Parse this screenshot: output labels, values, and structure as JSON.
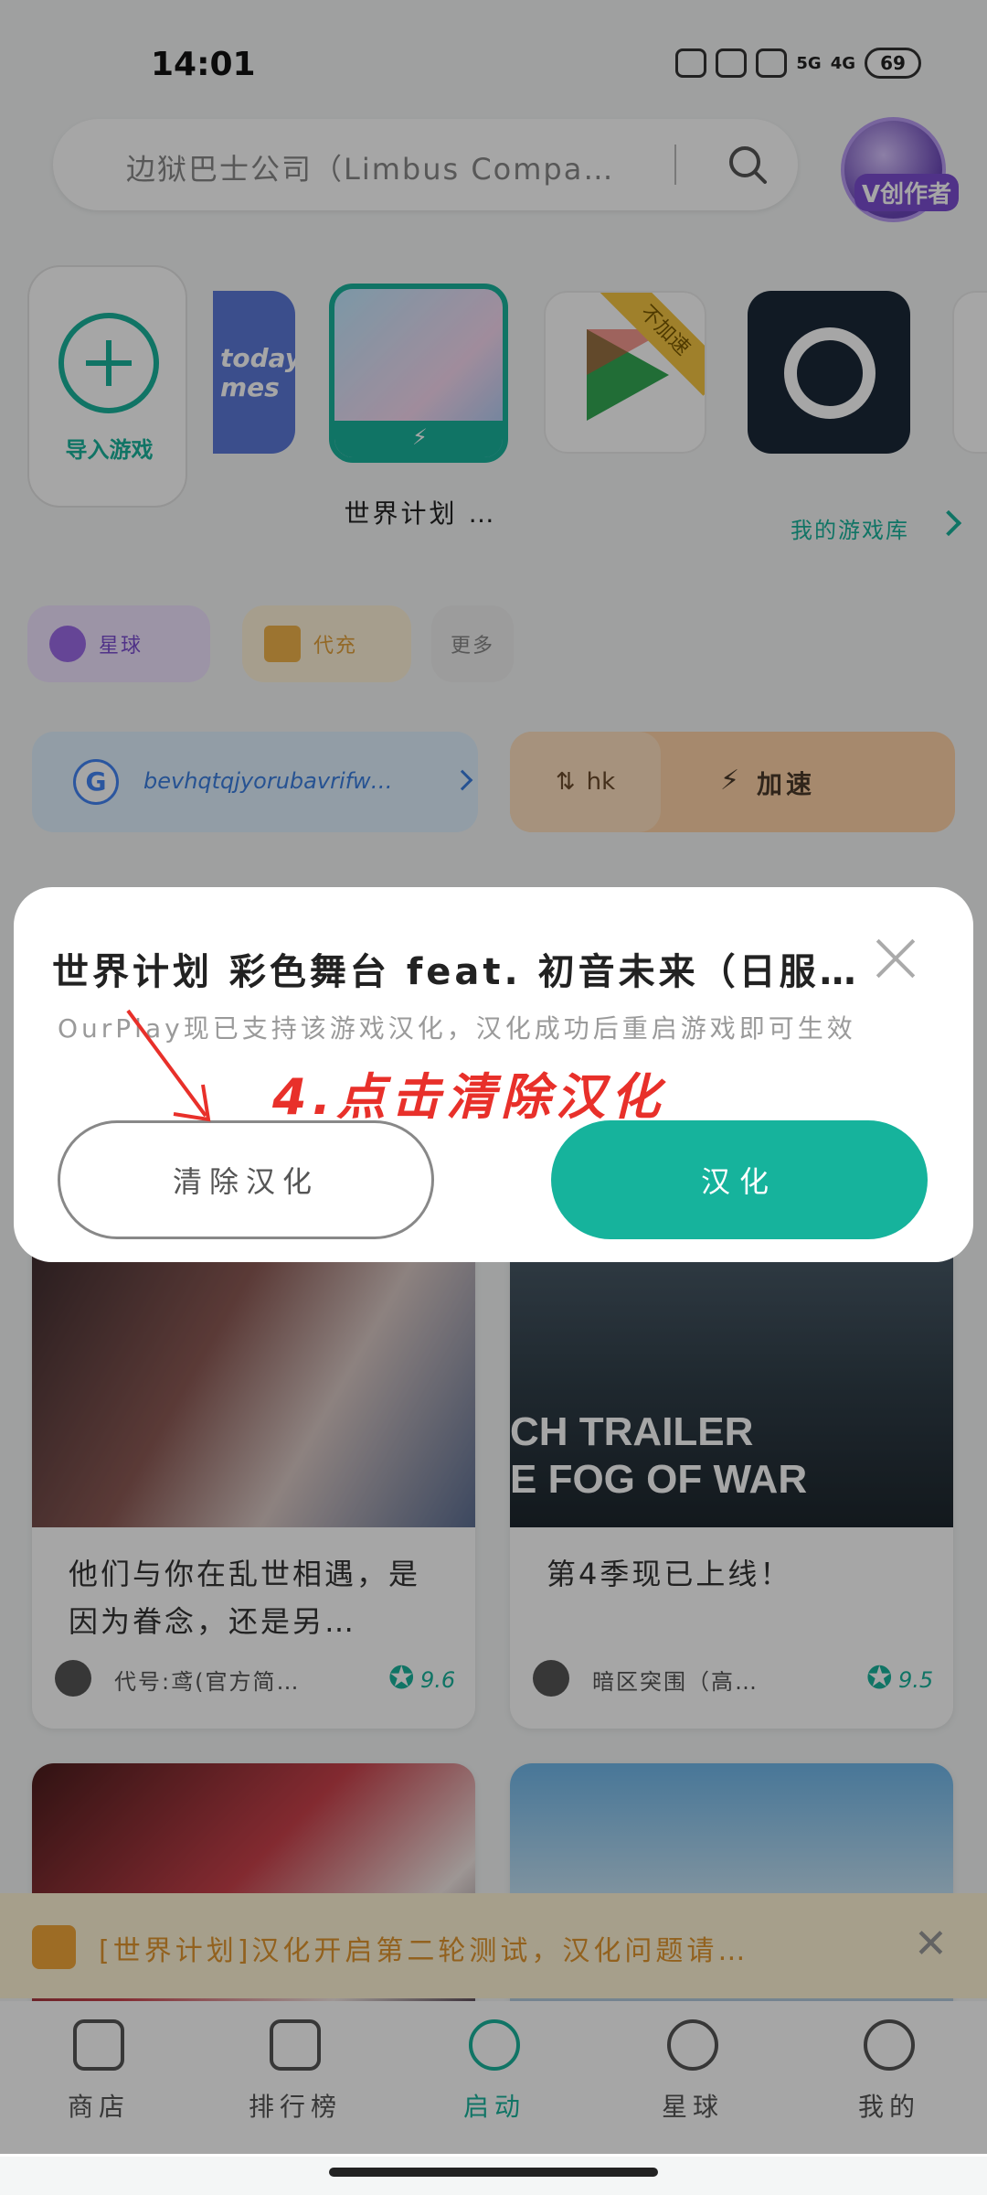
{
  "status_bar": {
    "time": "14:01",
    "net1": "5G",
    "net2": "4G",
    "battery": "69"
  },
  "search": {
    "placeholder": "边狱巴士公司（Limbus Compan…"
  },
  "avatar": {
    "badge": "V创作者"
  },
  "import": {
    "label": "导入游戏"
  },
  "games": [
    {
      "name": "today games",
      "label": "today\nmes"
    },
    {
      "name": "世界计划 …"
    },
    {
      "name": "Google Play",
      "ribbon": "不加速"
    },
    {
      "name": "Steam"
    }
  ],
  "library_link": "我的游戏库",
  "chips": {
    "planet": "星球",
    "gift": "代充",
    "more": "更多"
  },
  "account": {
    "text": "bevhqtqjyorubavrifw…"
  },
  "speed": {
    "region": "hk",
    "label": "加速"
  },
  "cards": [
    {
      "desc": "他们与你在乱世相遇，是因为眷念，还是另…",
      "author": "代号:鸢(官方简…",
      "score": "9.6"
    },
    {
      "desc": "第4季现已上线！",
      "author": "暗区突围（高…",
      "score": "9.5",
      "image_text": "CH TRAILER",
      "image_text2": "E FOG OF WAR"
    }
  ],
  "notice": {
    "text": "[世界计划]汉化开启第二轮测试，汉化问题请…"
  },
  "nav": [
    {
      "label": "商店"
    },
    {
      "label": "排行榜"
    },
    {
      "label": "启动"
    },
    {
      "label": "星球"
    },
    {
      "label": "我的"
    }
  ],
  "dialog": {
    "title": "世界计划 彩色舞台 feat. 初音未来（日服…",
    "description": "OurPlay现已支持该游戏汉化，汉化成功后重启游戏即可生效",
    "clear_button": "清除汉化",
    "translate_button": "汉化"
  },
  "annotation": "4.点击清除汉化",
  "colors": {
    "accent": "#16b39c",
    "annotation": "#e8302a"
  }
}
